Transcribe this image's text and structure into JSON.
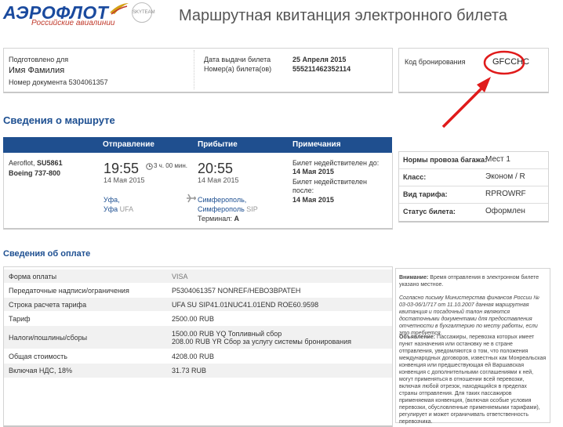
{
  "header": {
    "logo_text": "АЭРОФЛОТ",
    "logo_sub": "Российские авиалинии",
    "skyteam": "SKYTEAM",
    "title": "Маршрутная квитанция электронного билета"
  },
  "info_box": {
    "prepared_for_label": "Подготовлено для",
    "passenger_name": "Имя Фамилия",
    "document_number": "Номер документа 5304061357",
    "issue_date_label": "Дата выдачи билета",
    "issue_date": "25 Апреля 2015",
    "ticket_number_label": "Номер(а) билета(ов)",
    "ticket_number": "555211462352114"
  },
  "booking": {
    "label": "Код бронирования",
    "code": "GFCCHC"
  },
  "route": {
    "section_title": "Сведения о маршруте",
    "col_departure": "Отправление",
    "col_arrival": "Прибытие",
    "col_notes": "Примечания",
    "airline": "Aeroflot,",
    "flight": "SU5861",
    "aircraft": "Boeing 737-800",
    "dep_time": "19:55",
    "duration": "3 ч. 00 мин.",
    "dep_date": "14 Мая 2015",
    "dep_city": "Уфа,",
    "dep_airport_city": "Уфа",
    "dep_code": "UFA",
    "arr_time": "20:55",
    "arr_date": "14 Мая 2015",
    "arr_city": "Симферополь,",
    "arr_airport_city": "Симферополь",
    "arr_code": "SIP",
    "terminal_label": "Терминал:",
    "terminal": "А",
    "note1": "Билет недействителен до:",
    "note1_date": "14 Мая 2015",
    "note2": "Билет недействителен после:",
    "note2_date": "14 Мая 2015"
  },
  "baggage": [
    {
      "label": "Нормы провоза багажа:",
      "value": "Мест 1"
    },
    {
      "label": "Класс:",
      "value": "Эконом / R"
    },
    {
      "label": "Вид тарифа:",
      "value": "RPROWRF"
    },
    {
      "label": "Статус билета:",
      "value": "Оформлен"
    }
  ],
  "payment": {
    "section_title": "Сведения об оплате",
    "rows": [
      {
        "label": "Форма оплаты",
        "value": "VISA"
      },
      {
        "label": "Передаточные надписи/ограничения",
        "value": "P5304061357 NONREF/НЕВОЗВРАТЕН"
      },
      {
        "label": "Строка расчета тарифа",
        "value": "UFA SU SIP41.01NUC41.01END ROE60.9598"
      },
      {
        "label": "Тариф",
        "value": "2500.00 RUB"
      },
      {
        "label": "Налоги/пошлины/сборы",
        "value": "1500.00 RUB YQ Топливный сбор",
        "value2": "208.00 RUB YR Сбор за услугу системы бронирования"
      },
      {
        "label": "Общая стоимость",
        "value": "4208.00 RUB"
      },
      {
        "label": "Включая НДС, 18%",
        "value": "31.73 RUB"
      }
    ]
  },
  "notes": {
    "attention_label": "Внимание:",
    "attention_text": "Время отправления в электронном билете указано местное.",
    "letter_text": "Согласно письму Министерства финансов России № 03-03-06/1/717 от 11.10.2007 данная маршрутная квитанция и посадочный талон являются достаточными документами для предоставления отчетности в бухгалтерию по месту работы, если это требуется.",
    "notice_label": "Объявление:",
    "notice_text": "Пассажиры, перевозка которых имеет пункт назначения или остановку не в стране отправления, уведомляются о том, что положения международных договоров, известных как Монреальская конвенция или предшествующая ей Варшавская конвенция с дополнительными соглашениями к ней, могут применяться в отношении всей перевозки, включая любой отрезок, находящийся в пределах страны отправления. Для таких пассажиров применяемая конвенция, (включая особые условия перевозки, обусловленные применяемыми тарифами), регулирует и может ограничивать ответственность перевозчика."
  },
  "colors": {
    "brand_blue": "#1f4f8f",
    "highlight_red": "#e01b1b"
  }
}
